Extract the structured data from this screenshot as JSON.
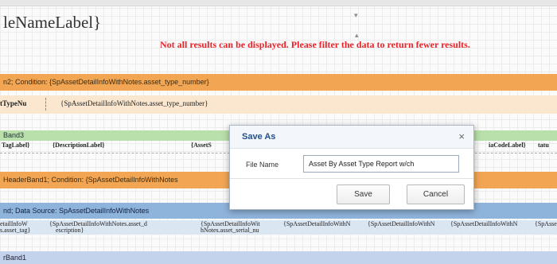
{
  "report": {
    "title_label": "leNameLabel}",
    "warning": "Not all results can be displayed. Please filter the data to return fewer results.",
    "group_band_1": "n2; Condition: {SpAssetDetailInfoWithNotes.asset_type_number}",
    "group_field_label": "tTypeNu",
    "group_field_value": "{SpAssetDetailInfoWithNotes.asset_type_number}",
    "band3": "Band3",
    "header_cells": [
      "TagLabel}",
      "{DescriptionLabel}",
      "{AssetS",
      "iaCodeLabel}",
      "tatu"
    ],
    "group_header_band": "HeaderBand1; Condition: {SpAssetDetailInfoWithNotes",
    "data_band": "nd; Data Source: SpAssetDetailInfoWithNotes",
    "data_cells": [
      "etailInfoW",
      "{SpAssetDetailInfoWithNotes.asset_d",
      "{SpAssetDetailInfoWit",
      "{SpAssetDetailInfoWithN",
      "{SpAssetDetailInfoWithN",
      "{SpAssetDetailInfoWithN",
      "{SpAsse"
    ],
    "data_cells_line2": [
      "s.asset_tag}",
      "escription}",
      "hNotes.asset_serial_nu"
    ],
    "footer_band": "rBand1"
  },
  "dialog": {
    "title": "Save As",
    "close_glyph": "×",
    "file_name_label": "File Name",
    "file_name_value": "Asset By Asset Type Report w/ch",
    "save_label": "Save",
    "cancel_label": "Cancel"
  },
  "colors": {
    "warning": "#e8232a",
    "group_band": "#f2a654",
    "band3": "#b9dfaa",
    "data_band": "#8fb4dc",
    "dialog_title": "#1f4f8f"
  }
}
